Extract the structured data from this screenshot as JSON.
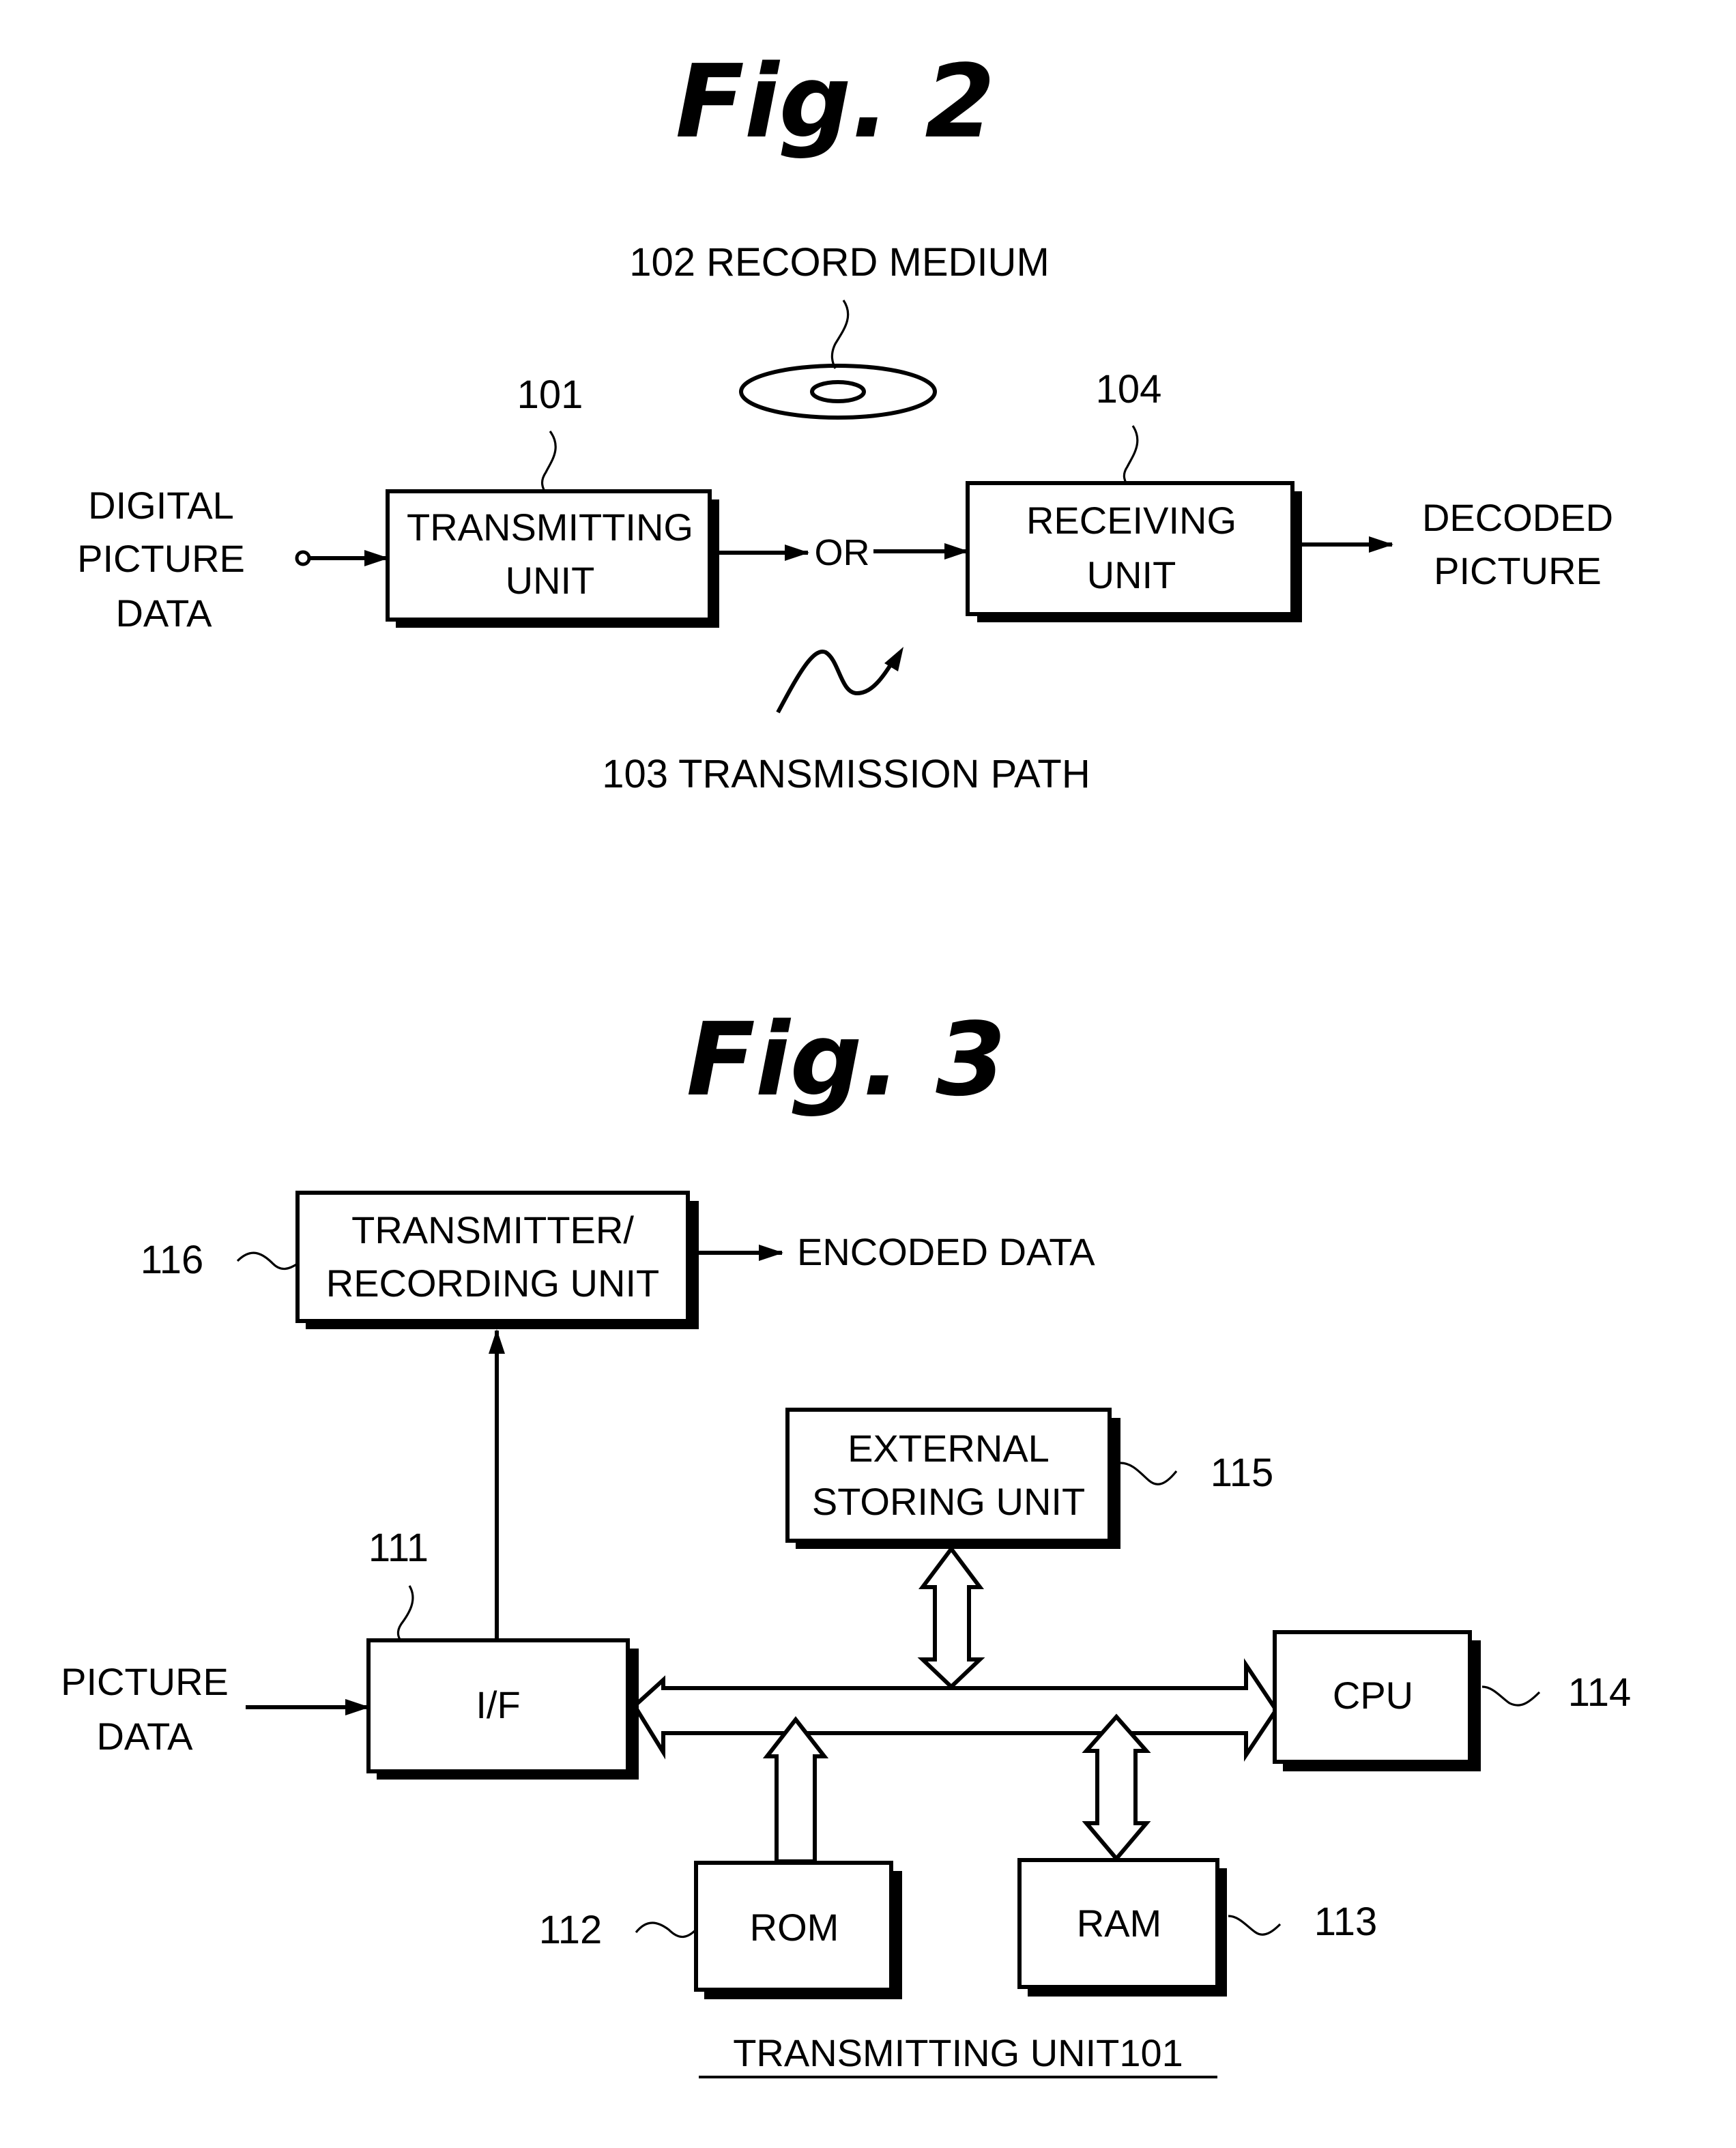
{
  "figure2": {
    "title": "Fig.  2",
    "record_medium_label": "102 RECORD MEDIUM",
    "transmitting_unit": {
      "ref": "101",
      "line1": "TRANSMITTING",
      "line2": "UNIT"
    },
    "receiving_unit": {
      "ref": "104",
      "line1": "RECEIVING",
      "line2": "UNIT"
    },
    "input_label": [
      "DIGITAL",
      "PICTURE",
      "DATA"
    ],
    "or_label": "OR",
    "output_label": [
      "DECODED",
      "PICTURE"
    ],
    "transmission_path_label": "103 TRANSMISSION PATH"
  },
  "figure3": {
    "title": "Fig.  3",
    "transmitter_recording_unit": {
      "ref": "116",
      "line1": "TRANSMITTER/",
      "line2": "RECORDING UNIT"
    },
    "encoded_data_label": "ENCODED DATA",
    "external_storing_unit": {
      "ref": "115",
      "line1": "EXTERNAL",
      "line2": "STORING UNIT"
    },
    "interface": {
      "ref": "111",
      "label": "I/F"
    },
    "cpu": {
      "ref": "114",
      "label": "CPU"
    },
    "rom": {
      "ref": "112",
      "label": "ROM"
    },
    "ram": {
      "ref": "113",
      "label": "RAM"
    },
    "input_label": [
      "PICTURE",
      "DATA"
    ],
    "caption": "TRANSMITTING UNIT101"
  }
}
